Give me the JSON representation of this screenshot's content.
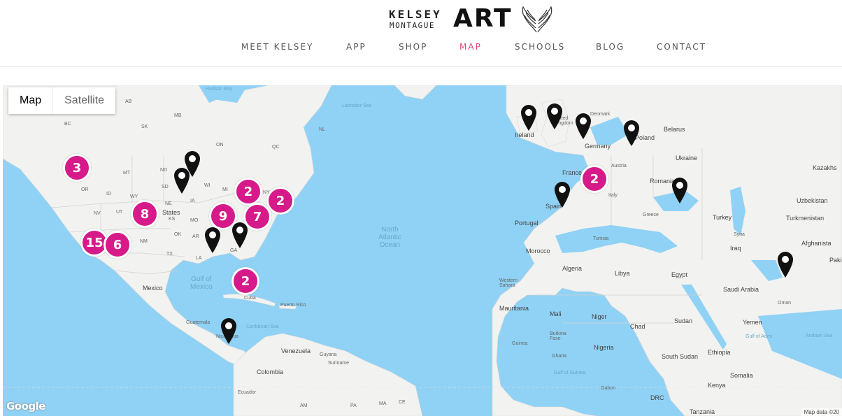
{
  "logo": {
    "line1": "KELSEY",
    "line2": "MONTAGUE",
    "art": "ART"
  },
  "nav": [
    "MEET KELSEY",
    "APP",
    "SHOP",
    "MAP",
    "SCHOOLS",
    "BLOG",
    "CONTACT"
  ],
  "nav_active": "MAP",
  "accent_color": "#e2487a",
  "cluster_color": "#d61a8a",
  "map": {
    "type_controls": {
      "map": "Map",
      "satellite": "Satellite",
      "selected": "Map"
    },
    "attribution_logo": "Google",
    "attribution": "Map data ©20",
    "cluster_counts": [
      "3",
      "2",
      "2",
      "8",
      "9",
      "7",
      "15",
      "6",
      "2",
      "2"
    ],
    "pin_count": 13,
    "labels": {
      "hudson": "Hudson Bay",
      "labrador": "Labrador Sea",
      "bc": "BC",
      "ab": "AB",
      "sk": "SK",
      "mb": "MB",
      "on": "ON",
      "qc": "QC",
      "nl": "NL",
      "mt": "MT",
      "nd": "ND",
      "or": "OR",
      "id": "ID",
      "wy": "WY",
      "sd": "SD",
      "ne": "NE",
      "nv": "NV",
      "ut": "UT",
      "ks": "KS",
      "mo": "MO",
      "ok": "OK",
      "nm": "NM",
      "ar": "AR",
      "tx": "TX",
      "la": "LA",
      "ia": "IA",
      "wi": "WI",
      "mi": "MI",
      "ga": "GA",
      "ny": "NY",
      "states": "States",
      "mexico": "Mexico",
      "gulf": "Gulf of\nMexico",
      "cuba": "Cuba",
      "puerto_rico": "Puerto Rico",
      "guatemala": "Guatemala",
      "nicaragua": "Nicaragua",
      "caribbean": "Caribbean Sea",
      "venezuela": "Venezuela",
      "guyana": "Guyana",
      "suriname": "Suriname",
      "colombia": "Colombia",
      "ecuador": "Ecuador",
      "am": "AM",
      "pa": "PA",
      "ma": "MA",
      "ce": "CE",
      "atlantic": "North\nAtlantic\nOcean",
      "ireland": "Ireland",
      "kingdom": "United\nKingdom",
      "denmark": "Denmark",
      "germany": "Germany",
      "poland": "Poland",
      "belarus": "Belarus",
      "ukraine": "Ukraine",
      "kazakhstan": "Kazakhs",
      "france": "France",
      "austria": "Austria",
      "italy": "Italy",
      "romania": "Romania",
      "spain": "Spain",
      "portugal": "Portugal",
      "greece": "Greece",
      "turkey": "Turkey",
      "uzbekistan": "Uzbekistan",
      "turkmenistan": "Turkmenistan",
      "syria": "Syria",
      "iraq": "Iraq",
      "afghanistan": "Afghanista",
      "pakistan": "Paki",
      "tunisia": "Tunisia",
      "morocco": "Morocco",
      "algeria": "Algeria",
      "libya": "Libya",
      "egypt": "Egypt",
      "saudi": "Saudi Arabia",
      "oman": "Oman",
      "western_sahara": "Western\nSahara",
      "mauritania": "Mauritania",
      "mali": "Mali",
      "niger": "Niger",
      "chad": "Chad",
      "sudan": "Sudan",
      "yemen": "Yemen",
      "burkina": "Burkina\nFaso",
      "guinea": "Guinea",
      "nigeria": "Nigeria",
      "ghana": "Ghana",
      "gulf_guinea": "Gulf of Guinea",
      "south_sudan": "South Sudan",
      "ethiopia": "Ethiopia",
      "somalia": "Somalia",
      "kenya": "Kenya",
      "gabon": "Gabon",
      "drc": "DRC",
      "tanzania": "Tanzania",
      "arabian_sea": "Arabian Sea",
      "gulf_aden": "Gulf of Aden"
    }
  }
}
